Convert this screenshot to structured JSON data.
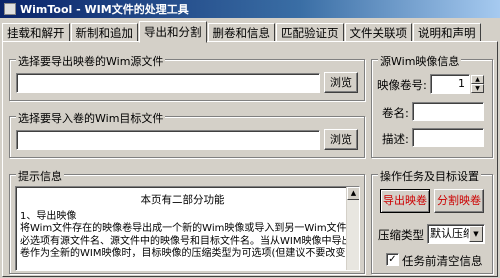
{
  "window": {
    "title": "WimTool - WIM文件的处理工具"
  },
  "tabs": [
    {
      "label": "挂载和解开"
    },
    {
      "label": "新制和追加"
    },
    {
      "label": "导出和分割",
      "active": true
    },
    {
      "label": "删卷和信息"
    },
    {
      "label": "匹配验证页"
    },
    {
      "label": "文件关联项"
    },
    {
      "label": "说明和声明"
    }
  ],
  "export_source": {
    "title": "选择要导出映卷的Wim源文件",
    "value": "",
    "browse_label": "浏览"
  },
  "import_target": {
    "title": "选择要导入卷的Wim目标文件",
    "value": "",
    "browse_label": "浏览"
  },
  "source_info": {
    "title": "源Wim映像信息",
    "volume_label": "映像卷号:",
    "volume_value": "1",
    "name_label": "卷名:",
    "name_value": "",
    "desc_label": "描述:",
    "desc_value": ""
  },
  "hint": {
    "title": "提示信息",
    "heading": "本页有二部分功能",
    "lines": [
      "1、导出映像",
      "    将Wim文件存在的映像卷导出成一个新的Wim映像或导入到另一Wim文件中，",
      "必选项有源文件名、源文件中的映像号和目标文件名。当从WIM映像中导出一个",
      "卷作为全新的WIM映像时，目标映像的压缩类型为可选项(但建议不要改变)。"
    ]
  },
  "task": {
    "title": "操作任务及目标设置",
    "export_btn": "导出映卷",
    "split_btn": "分割映卷",
    "compress_label": "压缩类型",
    "compress_value": "默认压缩",
    "clear_label": "任务前清空信息",
    "clear_checked": true,
    "accent_color": "#cc0000"
  }
}
